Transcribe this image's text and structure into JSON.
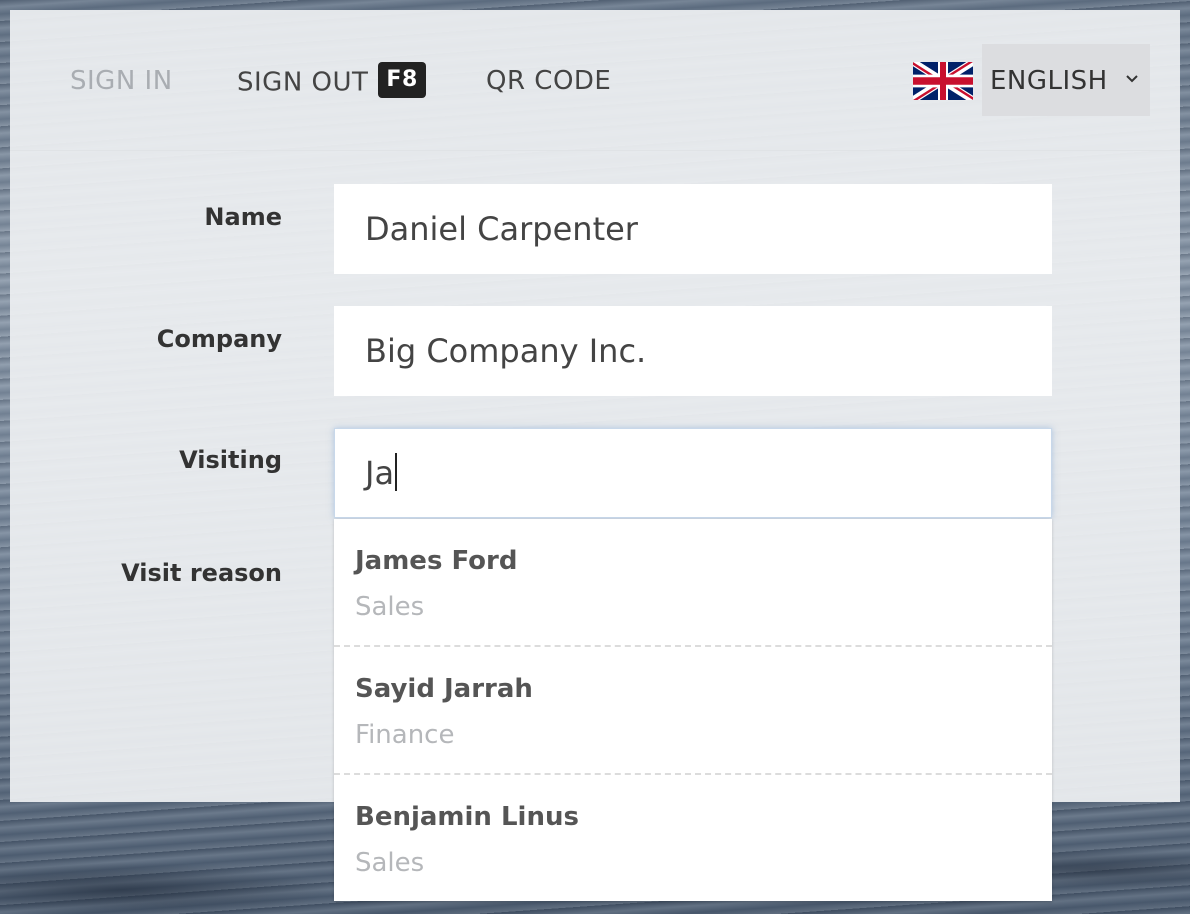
{
  "nav": {
    "sign_in": "SIGN IN",
    "sign_out": "SIGN OUT",
    "sign_out_shortcut": "F8",
    "qr_code": "QR CODE"
  },
  "language": {
    "selected": "ENGLISH",
    "flag_icon": "uk-flag-icon",
    "chevron_icon": "chevron-down-icon"
  },
  "form": {
    "name_label": "Name",
    "name_value": "Daniel Carpenter",
    "company_label": "Company",
    "company_value": "Big Company Inc.",
    "visiting_label": "Visiting",
    "visiting_value": "Ja",
    "visit_reason_label": "Visit reason"
  },
  "suggestions": [
    {
      "name": "James Ford",
      "department": "Sales"
    },
    {
      "name": "Sayid Jarrah",
      "department": "Finance"
    },
    {
      "name": "Benjamin Linus",
      "department": "Sales"
    }
  ],
  "colors": {
    "muted_nav": "#a9adb2",
    "text": "#444444",
    "shortcut_bg": "#222222",
    "language_bg": "#dcdde0"
  }
}
